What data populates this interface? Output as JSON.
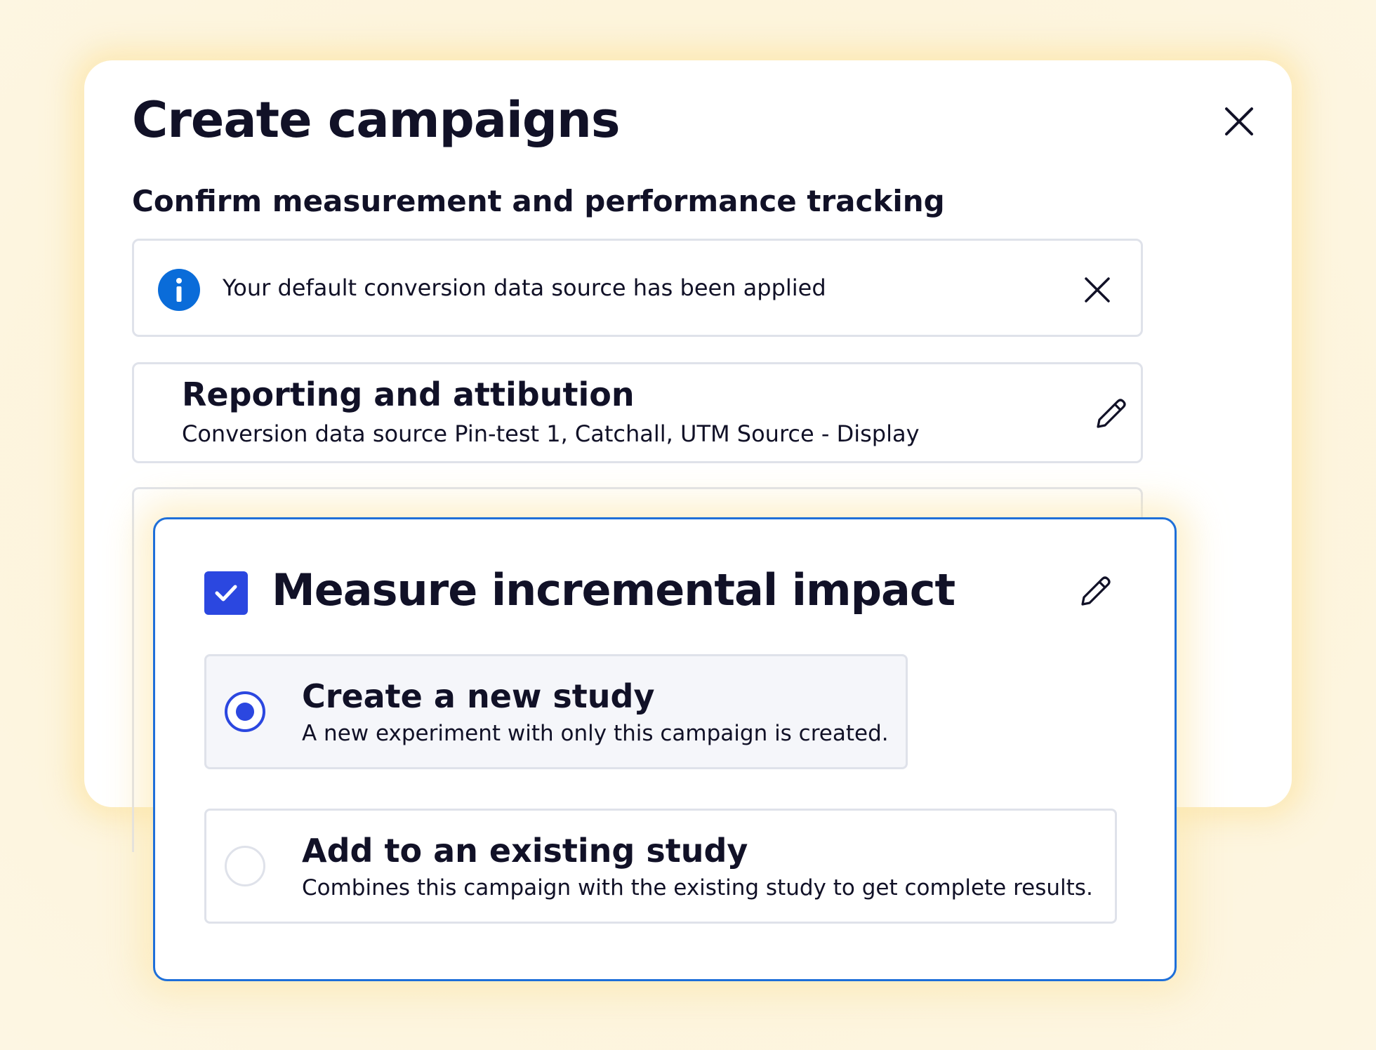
{
  "dialog": {
    "title": "Create campaigns",
    "close_icon": "close-icon"
  },
  "section": {
    "title": "Confirm measurement and performance tracking"
  },
  "info_banner": {
    "text": "Your default conversion data source has been applied",
    "icon": "info-icon",
    "icon_color": "#0a6cd9",
    "close_icon": "close-icon"
  },
  "reporting": {
    "title": "Reporting and attibution",
    "description": "Conversion data source Pin-test 1, Catchall, UTM Source - Display",
    "edit_icon": "pencil-icon"
  },
  "incremental": {
    "title": "Measure incremental impact",
    "checked": true,
    "edit_icon": "pencil-icon",
    "options": [
      {
        "title": "Create a new study",
        "description": "A new experiment with only this campaign is created.",
        "selected": true
      },
      {
        "title": "Add to an existing study",
        "description": "Combines this campaign with the existing study to get complete results.",
        "selected": false
      }
    ]
  },
  "colors": {
    "accent": "#2b47e0",
    "focus_border": "#1e6fd9",
    "background": "#fdf4dc",
    "text": "#111127"
  }
}
